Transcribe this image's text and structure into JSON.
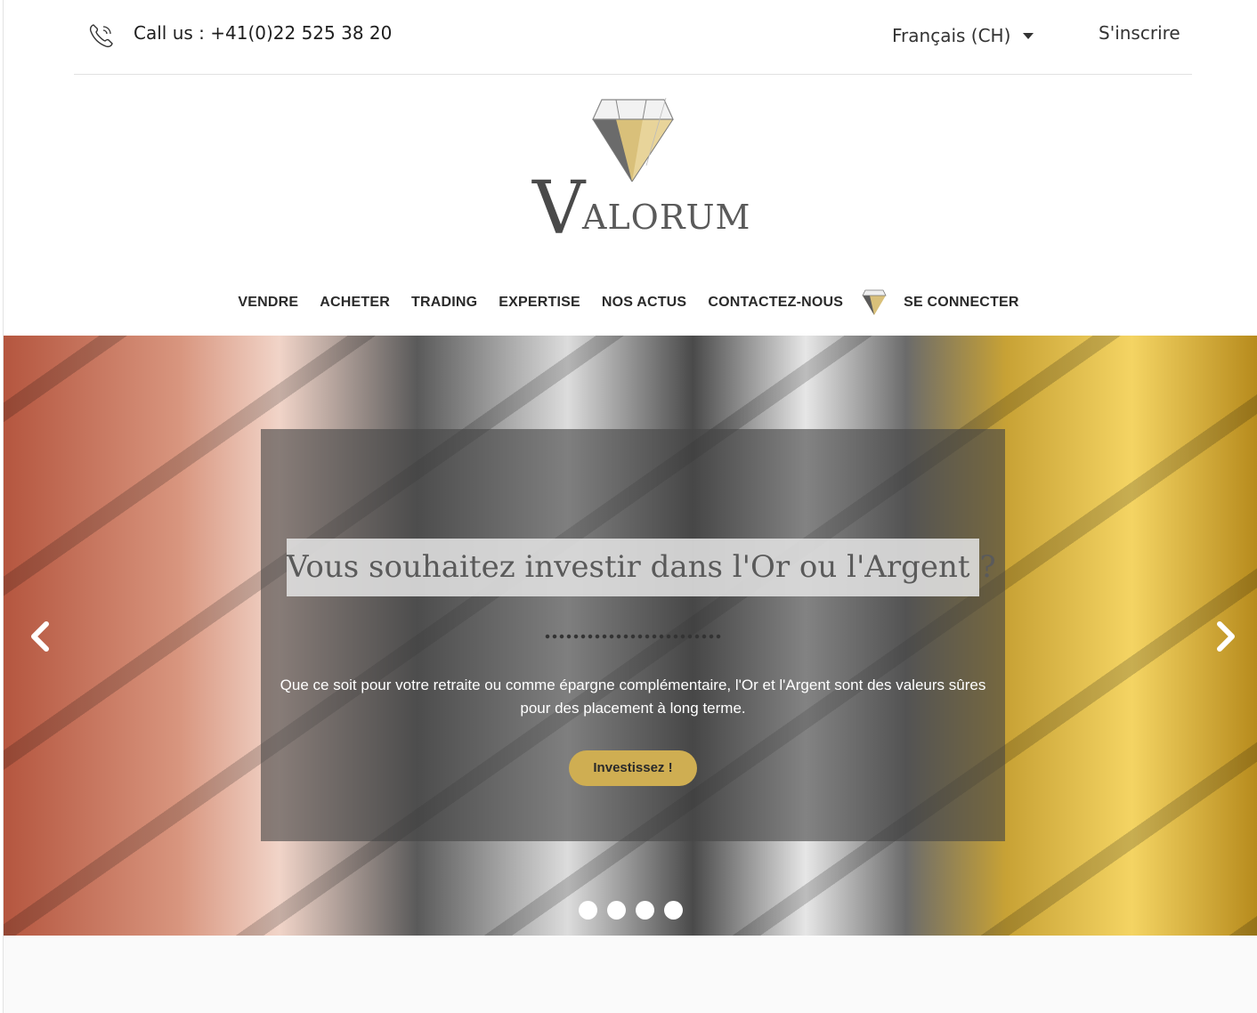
{
  "topbar": {
    "phone_icon": "phone-icon",
    "phone_text": "Call us : +41(0)22 525 38 20",
    "language": "Français (CH)",
    "signup": "S'inscrire"
  },
  "logo": {
    "v": "V",
    "rest": "ALORUM"
  },
  "nav": {
    "items": [
      "VENDRE",
      "ACHETER",
      "TRADING",
      "EXPERTISE",
      "NOS ACTUS",
      "CONTACTEZ-NOUS"
    ],
    "login": "SE CONNECTER"
  },
  "hero": {
    "headline": "Vous souhaitez investir dans l'Or ou l'Argent ?",
    "description": "Que ce soit pour votre retraite ou comme épargne complémentaire, l'Or et l'Argent sont des valeurs sûres pour des placement à long terme.",
    "cta": "Investissez !",
    "prev_icon": "chevron-left-icon",
    "next_icon": "chevron-right-icon",
    "slides_count": 4
  },
  "colors": {
    "accent_gold": "#cfae52",
    "text_dark": "#2a2a2a"
  }
}
